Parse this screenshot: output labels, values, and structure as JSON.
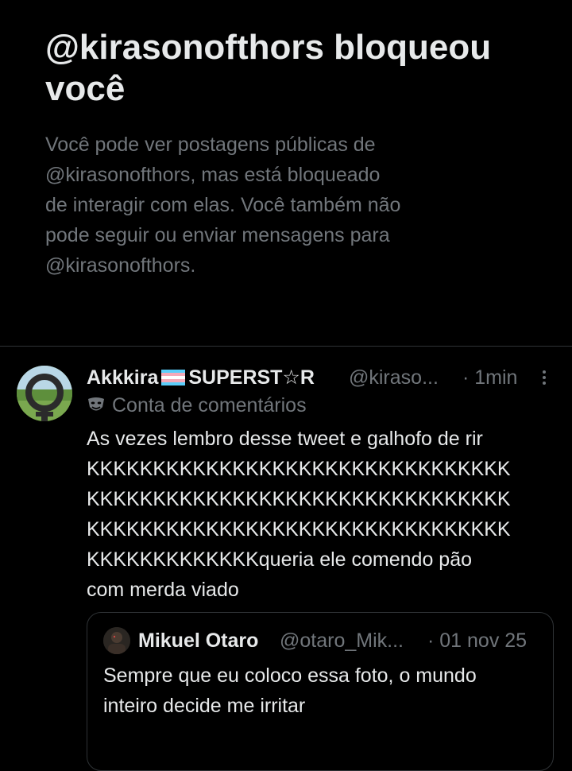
{
  "block_notice": {
    "title": "@kirasonofthors bloqueou você",
    "description_lines": [
      "Você pode ver postagens públicas de",
      "@kirasonofthors, mas está bloqueado",
      "de interagir com elas. Você também não",
      "pode seguir ou enviar mensagens para",
      "@kirasonofthors."
    ]
  },
  "tweet": {
    "display_name_pre": "Akkkira",
    "display_name_post": "SUPERST☆R",
    "flag_colors": [
      "#5BCEFA",
      "#F5A9B8",
      "#FFFFFF",
      "#F5A9B8",
      "#5BCEFA"
    ],
    "handle": "@kiraso...",
    "time": "· 1min",
    "sub_label_icon": "theater-mask-icon",
    "sub_label": "Conta de comentários",
    "text_lines": [
      "As vezes lembro desse tweet e galhofo de rir",
      "KKKKKKKKKKKKKKKKKKKKKKKKKKKKKKKK",
      "KKKKKKKKKKKKKKKKKKKKKKKKKKKKKKKK",
      "KKKKKKKKKKKKKKKKKKKKKKKKKKKKKKKK",
      "KKKKKKKKKKKKKqueria ele comendo pão",
      "com merda viado"
    ],
    "quote": {
      "name": "Mikuel Otaro",
      "handle": "@otaro_Mik...",
      "time": "· 01 nov 25",
      "text_lines": [
        "Sempre que eu coloco essa foto, o mundo",
        "inteiro decide me irritar"
      ]
    }
  }
}
